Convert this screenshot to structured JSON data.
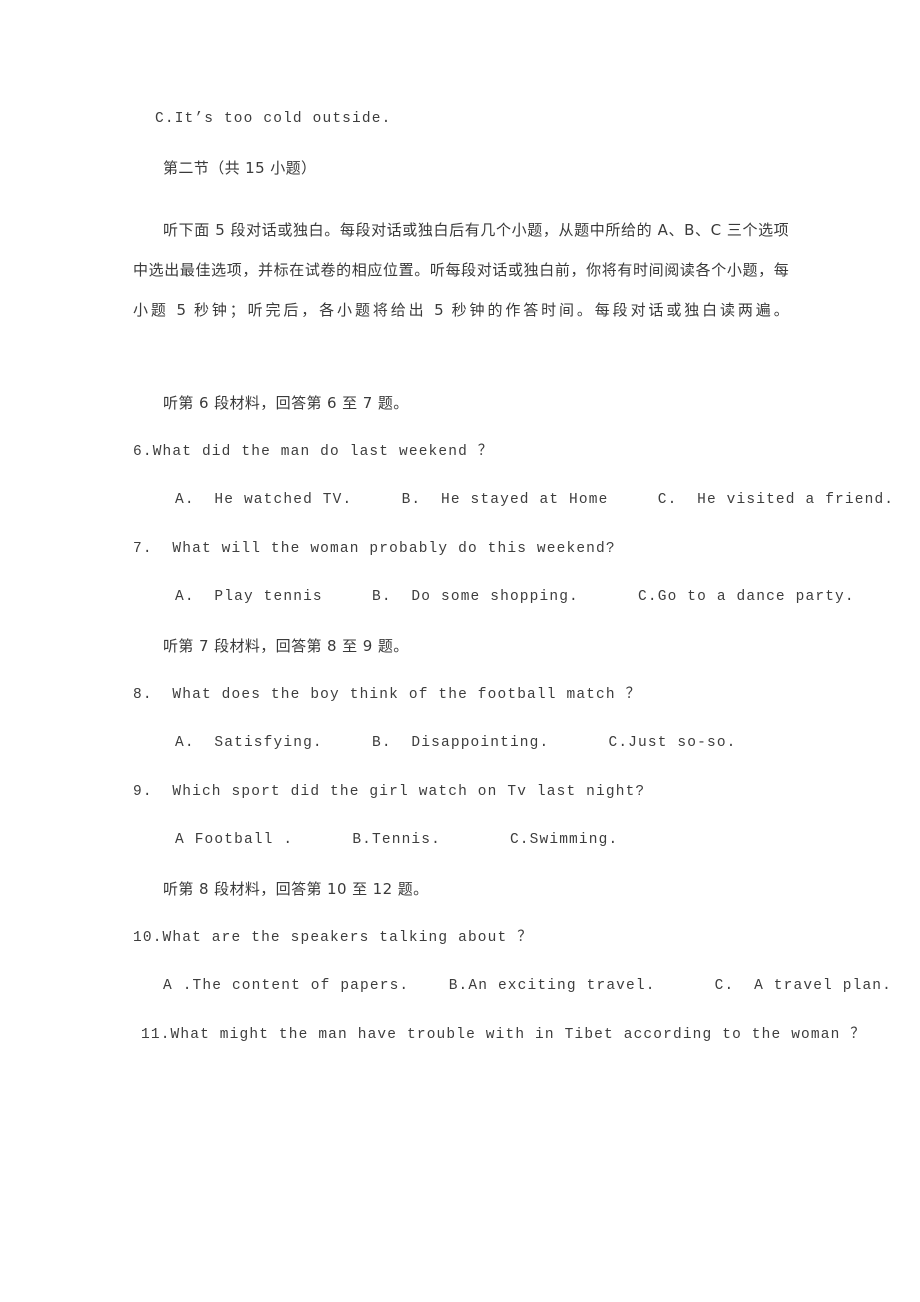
{
  "document": {
    "type": "english-listening-exam-page",
    "language_mix": "chinese-english"
  },
  "dangling_option": {
    "text": "C.It’s too cold outside."
  },
  "section": {
    "heading": "第二节（共 15 小题）",
    "instructions": "听下面 5 段对话或独白。每段对话或独白后有几个小题，从题中所给的 A、B、C 三个选项中选出最佳选项，并标在试卷的相应位置。听每段对话或独白前，你将有时间阅读各个小题，每小题 5 秒钟；听完后，各小题将给出 5 秒钟的作答时间。每段对话或独白读两遍。"
  },
  "materials": [
    {
      "id": "material-6",
      "cue": "听第 6 段材料，回答第 6 至 7 题。",
      "questions": [
        {
          "number": "6.",
          "stem": "6.What did the man do last weekend ？",
          "options": "A.  He watched TV.     B.  He stayed at Home     C.  He visited a friend."
        },
        {
          "number": "7.",
          "stem": "7.  What will the woman probably do this weekend?",
          "options": "A.  Play tennis     B.  Do some shopping.      C.Go to a dance party."
        }
      ]
    },
    {
      "id": "material-7",
      "cue": "听第 7 段材料，回答第 8 至 9 题。",
      "questions": [
        {
          "number": "8.",
          "stem": "8.  What does the boy think of the football match ？",
          "options": "A.  Satisfying.     B.  Disappointing.      C.Just so-so."
        },
        {
          "number": "9.",
          "stem": "9.  Which sport did the girl watch on Tv last night?",
          "options": "A Football .      B.Tennis.       C.Swimming."
        }
      ]
    },
    {
      "id": "material-8",
      "cue": "听第 8 段材料，回答第 10 至 12 题。",
      "questions": [
        {
          "number": "10.",
          "stem": "10.What are the speakers talking about ？",
          "options": "A .The content of papers.    B.An exciting travel.      C.  A travel plan."
        },
        {
          "number": "11.",
          "stem": "11.What might the man have trouble with in Tibet according to the woman ？",
          "options": ""
        }
      ]
    }
  ],
  "colors": {
    "page_background": "#ffffff",
    "text": "#3a3a3a"
  }
}
